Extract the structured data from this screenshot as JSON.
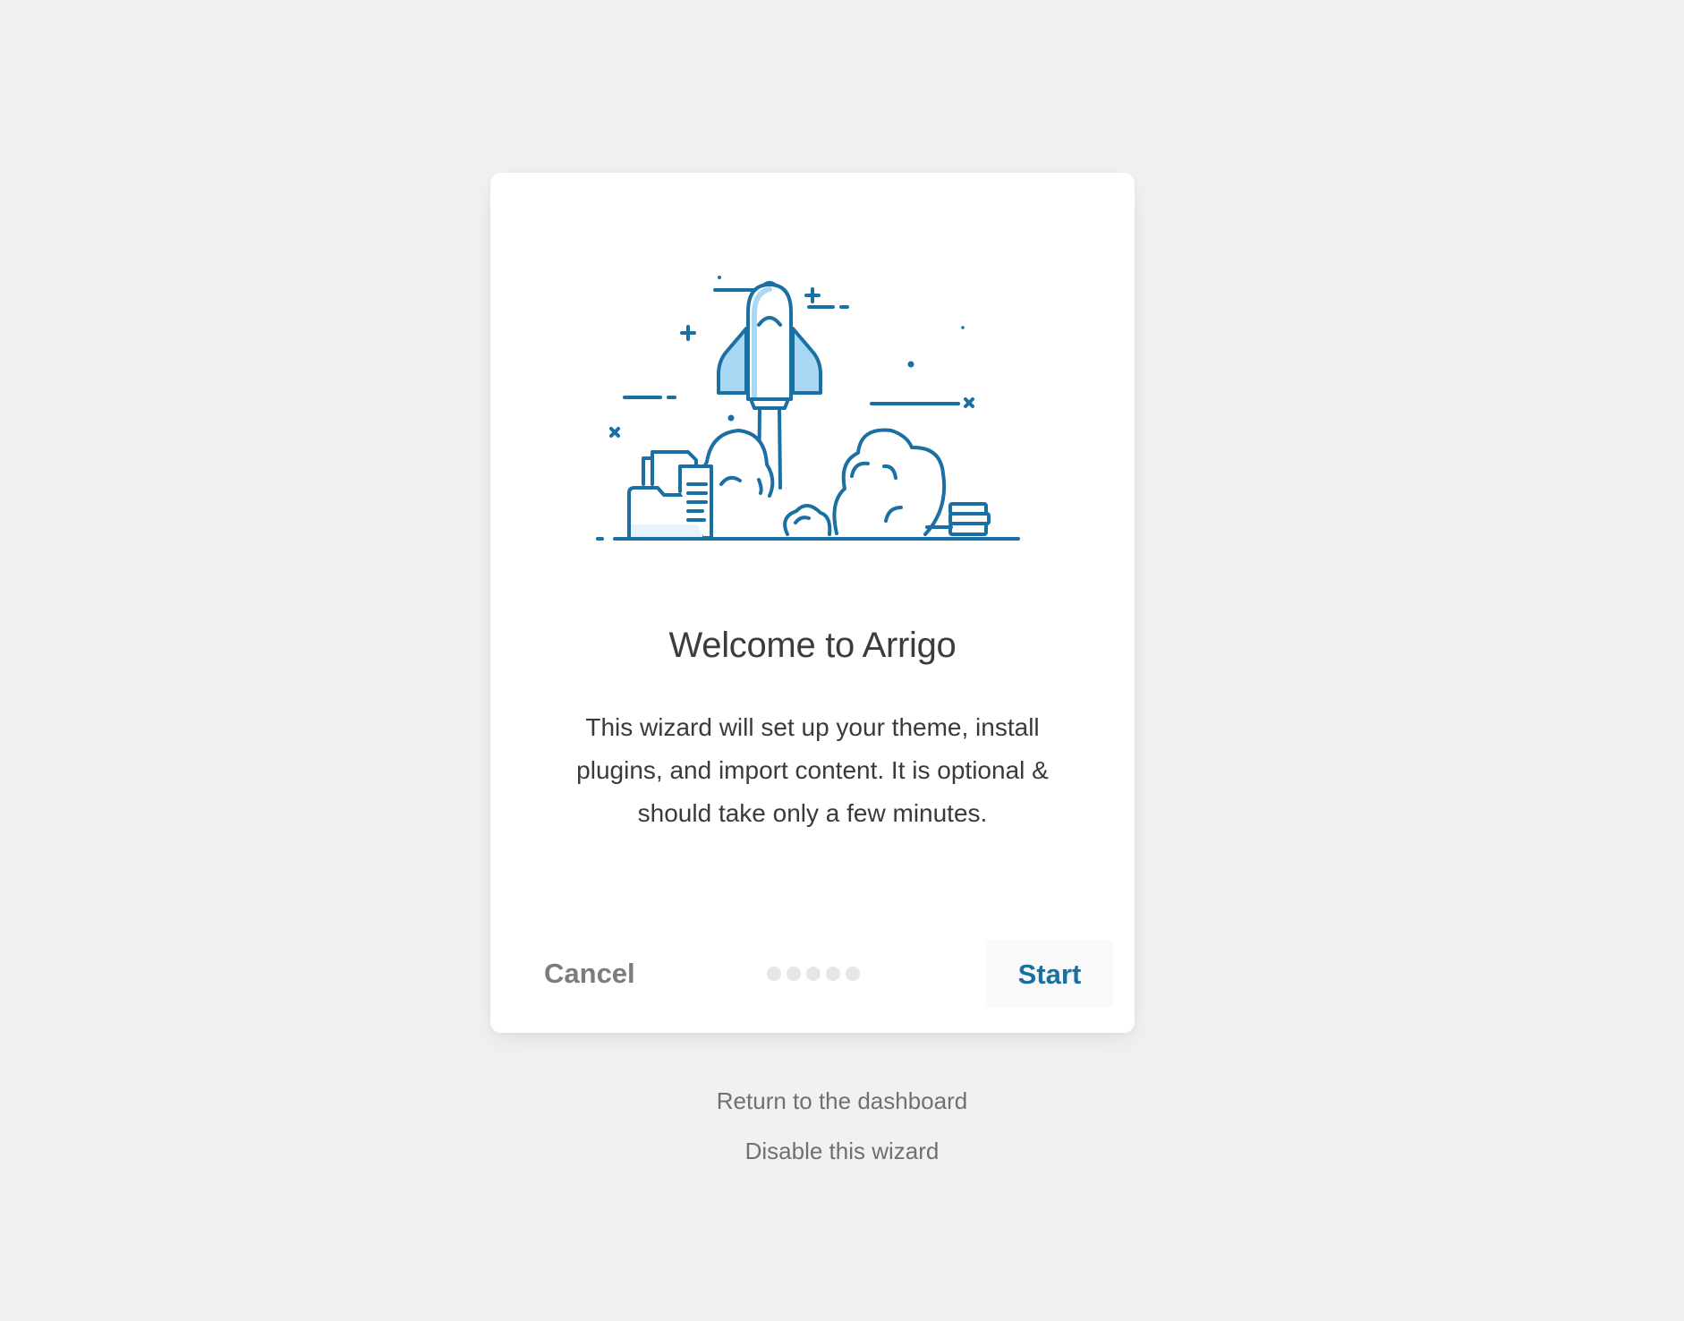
{
  "wizard": {
    "title": "Welcome to Arrigo",
    "description": "This wizard will set up your theme, install plugins, and import content. It is optional & should take only a few minutes.",
    "illustration_icon": "rocket-launch-icon",
    "cancel_label": "Cancel",
    "start_label": "Start",
    "progress": {
      "total_steps": 5,
      "current_step": 0
    }
  },
  "links": {
    "return_label": "Return to the dashboard",
    "disable_label": "Disable this wizard"
  },
  "colors": {
    "background": "#f1f1f1",
    "card": "#ffffff",
    "accent": "#1a6fa3",
    "illustration_stroke": "#1a6fa3",
    "illustration_fill": "#a9d8f5",
    "illustration_light_fill": "#e6f3fc",
    "muted_text": "#7c7c7c",
    "dot": "#e6e6e6"
  }
}
